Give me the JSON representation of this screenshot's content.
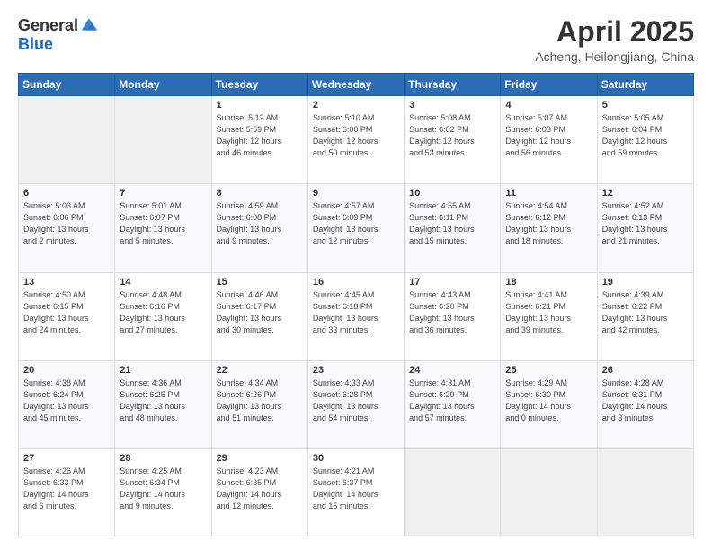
{
  "header": {
    "logo_general": "General",
    "logo_blue": "Blue",
    "month": "April 2025",
    "location": "Acheng, Heilongjiang, China"
  },
  "weekdays": [
    "Sunday",
    "Monday",
    "Tuesday",
    "Wednesday",
    "Thursday",
    "Friday",
    "Saturday"
  ],
  "weeks": [
    [
      {
        "day": "",
        "info": ""
      },
      {
        "day": "",
        "info": ""
      },
      {
        "day": "1",
        "info": "Sunrise: 5:12 AM\nSunset: 5:59 PM\nDaylight: 12 hours\nand 46 minutes."
      },
      {
        "day": "2",
        "info": "Sunrise: 5:10 AM\nSunset: 6:00 PM\nDaylight: 12 hours\nand 50 minutes."
      },
      {
        "day": "3",
        "info": "Sunrise: 5:08 AM\nSunset: 6:02 PM\nDaylight: 12 hours\nand 53 minutes."
      },
      {
        "day": "4",
        "info": "Sunrise: 5:07 AM\nSunset: 6:03 PM\nDaylight: 12 hours\nand 56 minutes."
      },
      {
        "day": "5",
        "info": "Sunrise: 5:05 AM\nSunset: 6:04 PM\nDaylight: 12 hours\nand 59 minutes."
      }
    ],
    [
      {
        "day": "6",
        "info": "Sunrise: 5:03 AM\nSunset: 6:06 PM\nDaylight: 13 hours\nand 2 minutes."
      },
      {
        "day": "7",
        "info": "Sunrise: 5:01 AM\nSunset: 6:07 PM\nDaylight: 13 hours\nand 5 minutes."
      },
      {
        "day": "8",
        "info": "Sunrise: 4:59 AM\nSunset: 6:08 PM\nDaylight: 13 hours\nand 9 minutes."
      },
      {
        "day": "9",
        "info": "Sunrise: 4:57 AM\nSunset: 6:09 PM\nDaylight: 13 hours\nand 12 minutes."
      },
      {
        "day": "10",
        "info": "Sunrise: 4:55 AM\nSunset: 6:11 PM\nDaylight: 13 hours\nand 15 minutes."
      },
      {
        "day": "11",
        "info": "Sunrise: 4:54 AM\nSunset: 6:12 PM\nDaylight: 13 hours\nand 18 minutes."
      },
      {
        "day": "12",
        "info": "Sunrise: 4:52 AM\nSunset: 6:13 PM\nDaylight: 13 hours\nand 21 minutes."
      }
    ],
    [
      {
        "day": "13",
        "info": "Sunrise: 4:50 AM\nSunset: 6:15 PM\nDaylight: 13 hours\nand 24 minutes."
      },
      {
        "day": "14",
        "info": "Sunrise: 4:48 AM\nSunset: 6:16 PM\nDaylight: 13 hours\nand 27 minutes."
      },
      {
        "day": "15",
        "info": "Sunrise: 4:46 AM\nSunset: 6:17 PM\nDaylight: 13 hours\nand 30 minutes."
      },
      {
        "day": "16",
        "info": "Sunrise: 4:45 AM\nSunset: 6:18 PM\nDaylight: 13 hours\nand 33 minutes."
      },
      {
        "day": "17",
        "info": "Sunrise: 4:43 AM\nSunset: 6:20 PM\nDaylight: 13 hours\nand 36 minutes."
      },
      {
        "day": "18",
        "info": "Sunrise: 4:41 AM\nSunset: 6:21 PM\nDaylight: 13 hours\nand 39 minutes."
      },
      {
        "day": "19",
        "info": "Sunrise: 4:39 AM\nSunset: 6:22 PM\nDaylight: 13 hours\nand 42 minutes."
      }
    ],
    [
      {
        "day": "20",
        "info": "Sunrise: 4:38 AM\nSunset: 6:24 PM\nDaylight: 13 hours\nand 45 minutes."
      },
      {
        "day": "21",
        "info": "Sunrise: 4:36 AM\nSunset: 6:25 PM\nDaylight: 13 hours\nand 48 minutes."
      },
      {
        "day": "22",
        "info": "Sunrise: 4:34 AM\nSunset: 6:26 PM\nDaylight: 13 hours\nand 51 minutes."
      },
      {
        "day": "23",
        "info": "Sunrise: 4:33 AM\nSunset: 6:28 PM\nDaylight: 13 hours\nand 54 minutes."
      },
      {
        "day": "24",
        "info": "Sunrise: 4:31 AM\nSunset: 6:29 PM\nDaylight: 13 hours\nand 57 minutes."
      },
      {
        "day": "25",
        "info": "Sunrise: 4:29 AM\nSunset: 6:30 PM\nDaylight: 14 hours\nand 0 minutes."
      },
      {
        "day": "26",
        "info": "Sunrise: 4:28 AM\nSunset: 6:31 PM\nDaylight: 14 hours\nand 3 minutes."
      }
    ],
    [
      {
        "day": "27",
        "info": "Sunrise: 4:26 AM\nSunset: 6:33 PM\nDaylight: 14 hours\nand 6 minutes."
      },
      {
        "day": "28",
        "info": "Sunrise: 4:25 AM\nSunset: 6:34 PM\nDaylight: 14 hours\nand 9 minutes."
      },
      {
        "day": "29",
        "info": "Sunrise: 4:23 AM\nSunset: 6:35 PM\nDaylight: 14 hours\nand 12 minutes."
      },
      {
        "day": "30",
        "info": "Sunrise: 4:21 AM\nSunset: 6:37 PM\nDaylight: 14 hours\nand 15 minutes."
      },
      {
        "day": "",
        "info": ""
      },
      {
        "day": "",
        "info": ""
      },
      {
        "day": "",
        "info": ""
      }
    ]
  ]
}
